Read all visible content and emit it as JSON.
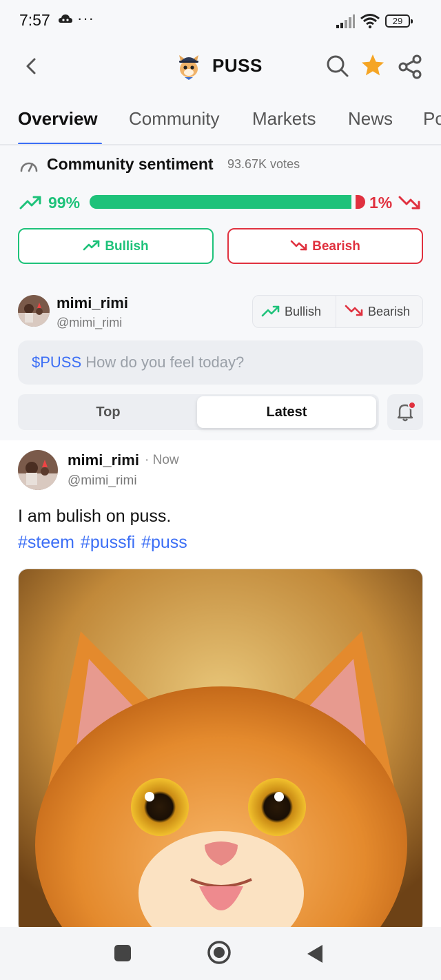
{
  "status_bar": {
    "time": "7:57",
    "dots": "···",
    "battery": "29"
  },
  "header": {
    "title": "PUSS"
  },
  "tabs": [
    "Overview",
    "Community",
    "Markets",
    "News",
    "Po"
  ],
  "sentiment": {
    "title": "Community sentiment",
    "votes": "93.67K votes",
    "bullish_pct_label": "99%",
    "bearish_pct_label": "1%",
    "bullish_fraction": 0.99,
    "bearish_fraction": 0.01,
    "bullish_button": "Bullish",
    "bearish_button": "Bearish",
    "bull_color": "#1ec27a",
    "bear_color": "#e0313f"
  },
  "composer": {
    "name": "mimi_rimi",
    "handle": "@mimi_rimi",
    "toggle_bullish": "Bullish",
    "toggle_bearish": "Bearish",
    "ticker": "$PUSS",
    "placeholder": "How do you feel today?",
    "feed_top": "Top",
    "feed_latest": "Latest"
  },
  "post": {
    "author": "mimi_rimi",
    "time": "· Now",
    "handle": "@mimi_rimi",
    "text": "I am bulish on puss.",
    "hashtags": "#steem #pussfi #puss"
  },
  "colors": {
    "accent": "#3b6ef5",
    "star": "#f5a524"
  }
}
